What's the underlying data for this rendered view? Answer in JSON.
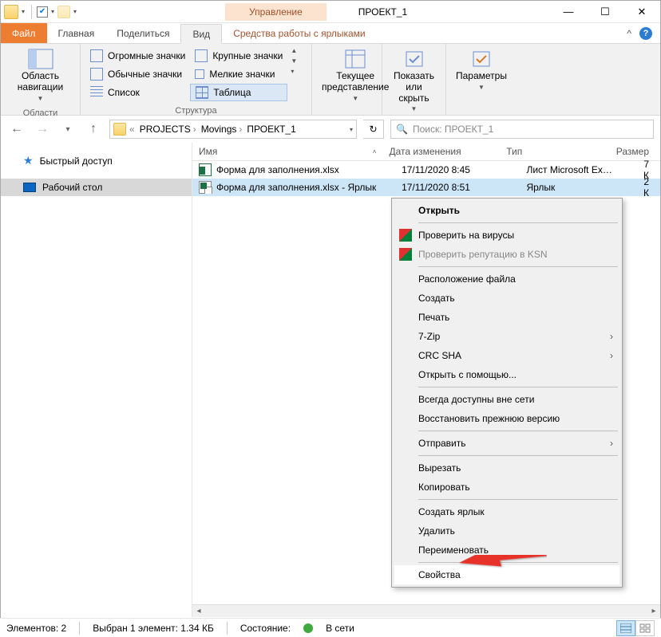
{
  "window": {
    "title": "ПРОЕКТ_1"
  },
  "tool_tab": "Управление",
  "tabs": {
    "file": "Файл",
    "home": "Главная",
    "share": "Поделиться",
    "view": "Вид",
    "shortcut": "Средства работы с ярлыками"
  },
  "ribbon": {
    "panes_group": "Области",
    "nav_pane": "Область навигации",
    "layout_group": "Структура",
    "huge": "Огромные значки",
    "large": "Крупные значки",
    "medium": "Обычные значки",
    "small": "Мелкие значки",
    "list": "Список",
    "table": "Таблица",
    "current_view_group": "Текущее представление",
    "current_view": "Текущее представление",
    "show_hide": "Показать или скрыть",
    "options": "Параметры"
  },
  "breadcrumb": {
    "p1": "PROJECTS",
    "p2": "Movings",
    "p3": "ПРОЕКТ_1"
  },
  "search": {
    "placeholder": "Поиск: ПРОЕКТ_1"
  },
  "nav": {
    "quick": "Быстрый доступ",
    "desktop": "Рабочий стол"
  },
  "columns": {
    "name": "Имя",
    "date": "Дата изменения",
    "type": "Тип",
    "size": "Размер"
  },
  "files": [
    {
      "name": "Форма для заполнения.xlsx",
      "date": "17/11/2020 8:45",
      "type": "Лист Microsoft Ex…",
      "size": "7 К"
    },
    {
      "name": "Форма для заполнения.xlsx - Ярлык",
      "date": "17/11/2020 8:51",
      "type": "Ярлык",
      "size": "2 К"
    }
  ],
  "context": {
    "open": "Открыть",
    "virus": "Проверить на вирусы",
    "ksn": "Проверить репутацию в KSN",
    "file_loc": "Расположение файла",
    "create": "Создать",
    "print": "Печать",
    "zip": "7-Zip",
    "crc": "CRC SHA",
    "open_with": "Открыть с помощью...",
    "offline": "Всегда доступны вне сети",
    "restore": "Восстановить прежнюю версию",
    "send_to": "Отправить",
    "cut": "Вырезать",
    "copy": "Копировать",
    "mklnk": "Создать ярлык",
    "delete": "Удалить",
    "rename": "Переименовать",
    "props": "Свойства"
  },
  "status": {
    "items": "Элементов: 2",
    "selected": "Выбран 1 элемент: 1.34 КБ",
    "state_label": "Состояние:",
    "net": "В сети"
  }
}
